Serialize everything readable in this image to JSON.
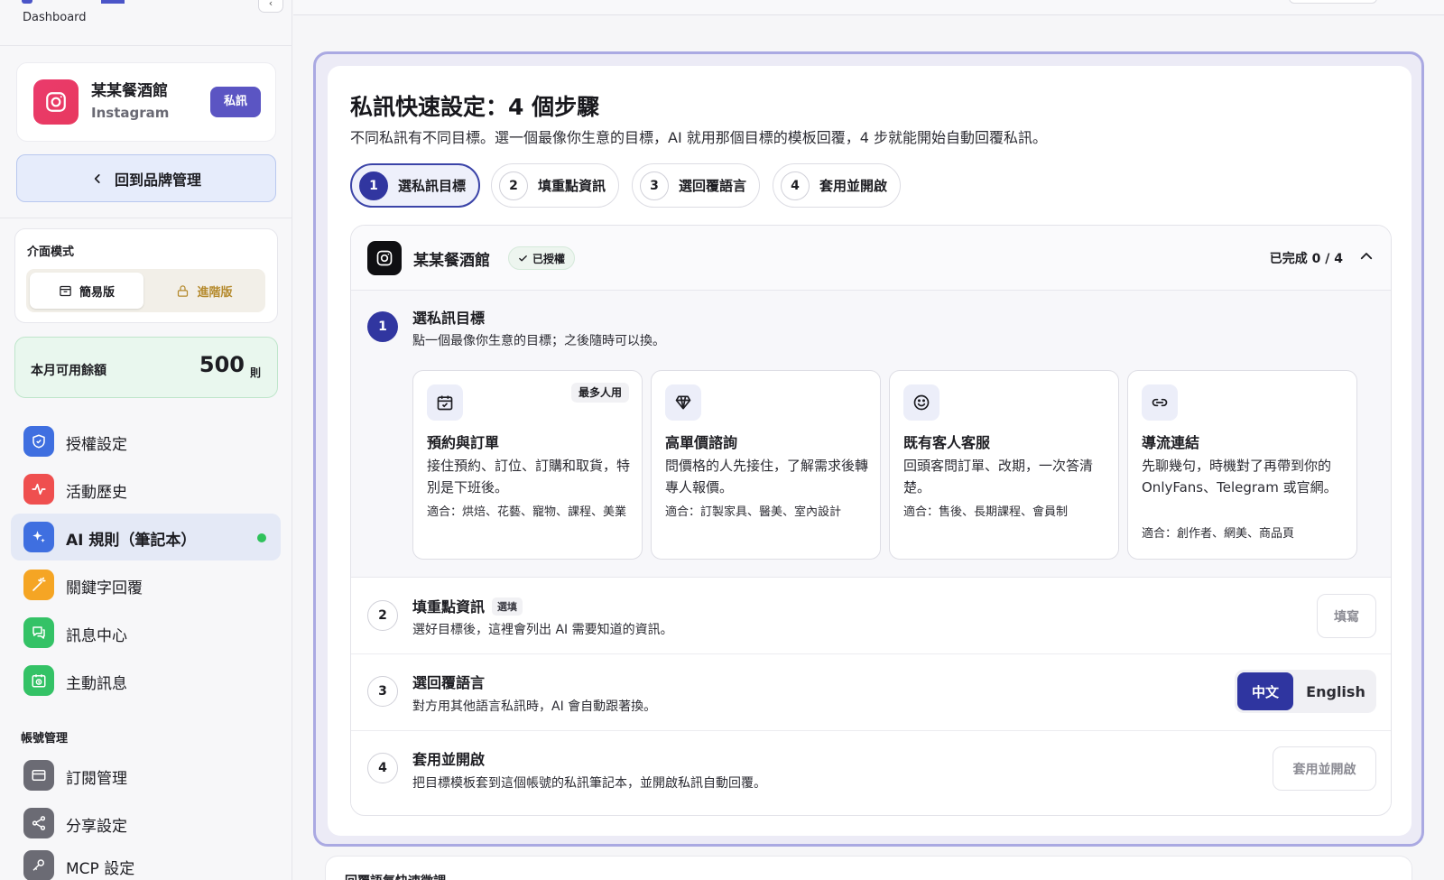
{
  "sidebar": {
    "dashboard_label": "Dashboard",
    "collapse_glyph": "‹",
    "brand": {
      "name": "某某餐酒館",
      "platform": "Instagram",
      "badge": "私訊"
    },
    "back_button": "回到品牌管理",
    "interface_mode": {
      "title": "介面模式",
      "simple": "簡易版",
      "advanced": "進階版",
      "selected": "簡易版"
    },
    "quota": {
      "label": "本月可用餘額",
      "value": "500",
      "unit": "則"
    },
    "nav_items": [
      {
        "label": "授權設定",
        "icon": "shield-icon",
        "color": "#3f6fe0"
      },
      {
        "label": "活動歷史",
        "icon": "activity-icon",
        "color": "#ef4f4f"
      },
      {
        "label": "AI 規則（筆記本）",
        "icon": "sparkles-icon",
        "color": "#3f6fe0",
        "active": true,
        "status_color": "#2fc25b"
      },
      {
        "label": "關鍵字回覆",
        "icon": "magic-wand-icon",
        "color": "#f5a524"
      },
      {
        "label": "訊息中心",
        "icon": "chat-icon",
        "color": "#34c266"
      },
      {
        "label": "主動訊息",
        "icon": "calendar-clock-icon",
        "color": "#34c266"
      }
    ],
    "account_section": "帳號管理",
    "account_items": [
      {
        "label": "訂閱管理",
        "icon": "credit-card-icon",
        "color": "#6b6b74"
      },
      {
        "label": "分享設定",
        "icon": "share-icon",
        "color": "#6b6b74"
      },
      {
        "label": "MCP 設定",
        "icon": "key-icon",
        "color": "#6b6b74"
      }
    ]
  },
  "main": {
    "title": "私訊快速設定：4 個步驟",
    "description": "不同私訊有不同目標。選一個最像你生意的目標，AI 就用那個目標的模板回覆，4 步就能開始自動回覆私訊。",
    "steps": [
      {
        "num": "1",
        "label": "選私訊目標",
        "active": true
      },
      {
        "num": "2",
        "label": "填重點資訊"
      },
      {
        "num": "3",
        "label": "選回覆語言"
      },
      {
        "num": "4",
        "label": "套用並開啟"
      }
    ],
    "panel": {
      "account_name": "某某餐酒館",
      "auth_badge": "已授權",
      "progress": "已完成 0 / 4",
      "step1": {
        "num": "1",
        "title": "選私訊目標",
        "desc": "點一個最像你生意的目標；之後隨時可以換。",
        "goals": [
          {
            "icon": "calendar-check-icon",
            "tag": "最多人用",
            "title": "預約與訂單",
            "desc": "接住預約、訂位、訂購和取貨，特別是下班後。",
            "fit": "適合：烘焙、花藝、寵物、課程、美業"
          },
          {
            "icon": "diamond-icon",
            "tag": "",
            "title": "高單價諮詢",
            "desc": "問價格的人先接住，了解需求後轉專人報價。",
            "fit": "適合：訂製家具、醫美、室內設計"
          },
          {
            "icon": "smile-icon",
            "tag": "",
            "title": "既有客人客服",
            "desc": "回頭客問訂單、改期，一次答清楚。",
            "fit": "適合：售後、長期課程、會員制"
          },
          {
            "icon": "link-icon",
            "tag": "",
            "title": "導流連結",
            "desc": "先聊幾句，時機對了再帶到你的 OnlyFans、Telegram 或官網。",
            "fit": "適合：創作者、網美、商品頁"
          }
        ]
      },
      "step2": {
        "num": "2",
        "title": "填重點資訊",
        "tag": "選填",
        "desc": "選好目標後，這裡會列出 AI 需要知道的資訊。",
        "button": "填寫"
      },
      "step3": {
        "num": "3",
        "title": "選回覆語言",
        "desc": "對方用其他語言私訊時，AI 會自動跟著換。",
        "lang_zh": "中文",
        "lang_en": "English",
        "selected": "中文"
      },
      "step4": {
        "num": "4",
        "title": "套用並開啟",
        "desc": "把目標模板套到這個帳號的私訊筆記本，並開啟私訊自動回覆。",
        "button": "套用並開啟"
      }
    },
    "next_section_title": "回覆語氣快速微調"
  }
}
